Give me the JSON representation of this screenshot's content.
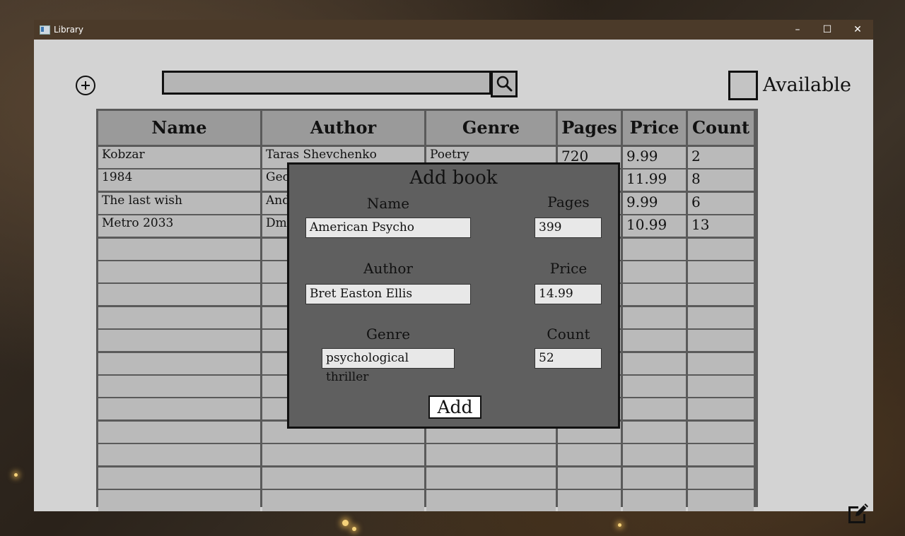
{
  "window": {
    "title": "Library",
    "minimize": "–",
    "maximize": "☐",
    "close": "✕"
  },
  "toolbar": {
    "search_value": "",
    "available_label": "Available"
  },
  "table": {
    "headers": [
      "Name",
      "Author",
      "Genre",
      "Pages",
      "Price",
      "Count"
    ],
    "rows": [
      [
        "Kobzar",
        "Taras Shevchenko",
        "Poetry",
        "720",
        "9.99",
        "2"
      ],
      [
        "1984",
        "Geo",
        "",
        "",
        "11.99",
        "8"
      ],
      [
        "The last wish",
        "And",
        "",
        "",
        "9.99",
        "6"
      ],
      [
        "Metro 2033",
        "Dm",
        "",
        "",
        "10.99",
        "13"
      ]
    ],
    "empty_rows": 12
  },
  "dialog": {
    "title": "Add book",
    "name_label": "Name",
    "name_value": "American Psycho",
    "pages_label": "Pages",
    "pages_value": "399",
    "author_label": "Author",
    "author_value": "Bret Easton Ellis",
    "price_label": "Price",
    "price_value": "14.99",
    "genre_label": "Genre",
    "genre_value": "psychological thriller",
    "count_label": "Count",
    "count_value": "52",
    "add_label": "Add"
  }
}
